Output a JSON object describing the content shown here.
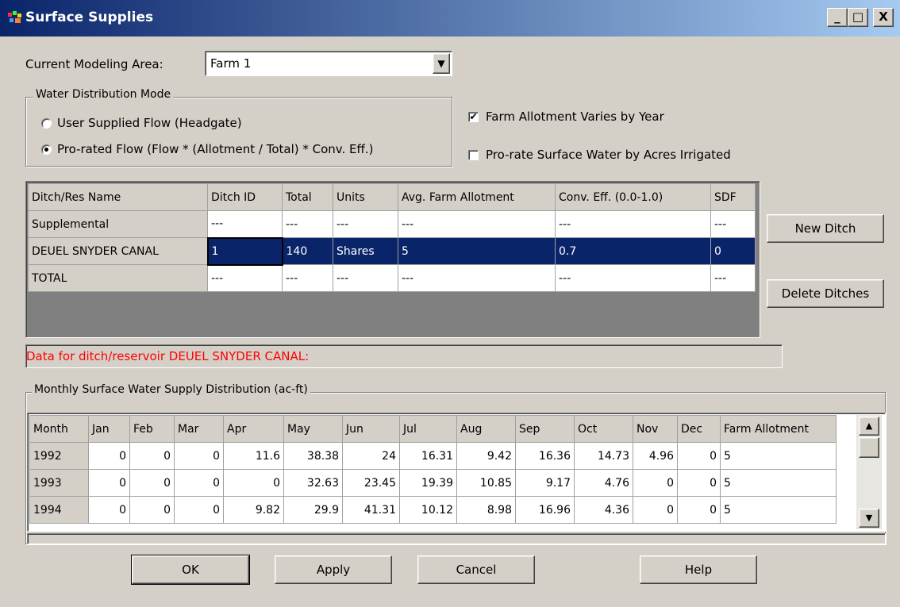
{
  "window": {
    "title": "Surface Supplies",
    "min_label": "_",
    "max_label": "□",
    "close_label": "X"
  },
  "modeling_area": {
    "label": "Current Modeling Area:",
    "value": "Farm 1"
  },
  "distribution_mode": {
    "group_label": "Water Distribution Mode",
    "options": [
      {
        "label": "User Supplied Flow (Headgate)",
        "selected": false
      },
      {
        "label": "Pro-rated Flow (Flow * (Allotment / Total) * Conv. Eff.)",
        "selected": true
      }
    ]
  },
  "checkboxes": [
    {
      "label": "Farm Allotment Varies by Year",
      "checked": true
    },
    {
      "label": "Pro-rate Surface Water by Acres Irrigated",
      "checked": false
    }
  ],
  "ditch_table": {
    "headers": [
      "Ditch/Res Name",
      "Ditch ID",
      "Total",
      "Units",
      "Avg. Farm Allotment",
      "Conv. Eff. (0.0-1.0)",
      "SDF"
    ],
    "rows": [
      [
        "Supplemental",
        "---",
        "---",
        "---",
        "---",
        "---",
        "---"
      ],
      [
        "DEUEL SNYDER CANAL",
        "1",
        "140",
        "Shares",
        "5",
        "0.7",
        "0"
      ],
      [
        "TOTAL",
        "---",
        "---",
        "---",
        "---",
        "---",
        "---"
      ]
    ],
    "selected_row": 1
  },
  "side_buttons": {
    "new_ditch": "New Ditch",
    "delete_ditches": "Delete Ditches"
  },
  "ditch_data_label": "Data for ditch/reservoir DEUEL SNYDER CANAL:",
  "monthly": {
    "group_label": "Monthly Surface Water Supply Distribution (ac-ft)",
    "headers": [
      "Month",
      "Jan",
      "Feb",
      "Mar",
      "Apr",
      "May",
      "Jun",
      "Jul",
      "Aug",
      "Sep",
      "Oct",
      "Nov",
      "Dec",
      "Farm Allotment"
    ],
    "rows": [
      [
        "1992",
        "0",
        "0",
        "0",
        "11.6",
        "38.38",
        "24",
        "16.31",
        "9.42",
        "16.36",
        "14.73",
        "4.96",
        "0",
        "5"
      ],
      [
        "1993",
        "0",
        "0",
        "0",
        "0",
        "32.63",
        "23.45",
        "19.39",
        "10.85",
        "9.17",
        "4.76",
        "0",
        "0",
        "5"
      ],
      [
        "1994",
        "0",
        "0",
        "0",
        "9.82",
        "29.9",
        "41.31",
        "10.12",
        "8.98",
        "16.96",
        "4.36",
        "0",
        "0",
        "5"
      ]
    ]
  },
  "footer_buttons": {
    "ok": "OK",
    "apply": "Apply",
    "cancel": "Cancel",
    "help": "Help"
  },
  "icons": {
    "dropdown": "▼",
    "scroll_up": "▲",
    "scroll_down": "▼",
    "check": "✔"
  },
  "colors": {
    "title_start": "#0a246a",
    "title_end": "#a6caf0",
    "selection": "#0a246a",
    "error_text": "#ff0000",
    "face": "#d4d0c8"
  }
}
